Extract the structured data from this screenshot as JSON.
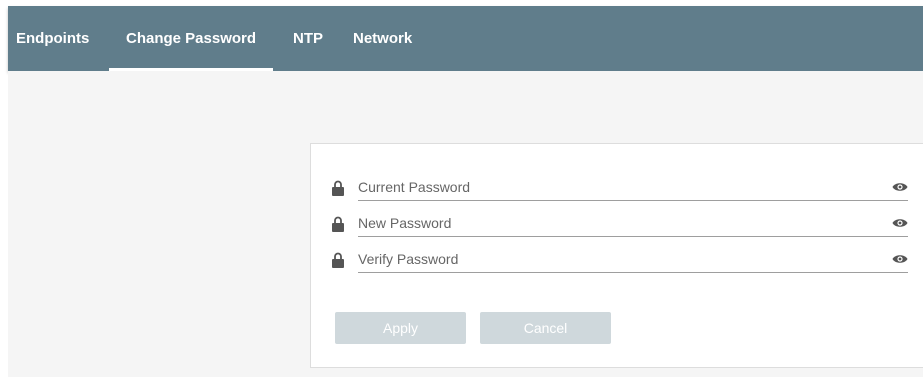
{
  "nav": {
    "tabs": [
      {
        "label": "Endpoints"
      },
      {
        "label": "Change Password"
      },
      {
        "label": "NTP"
      },
      {
        "label": "Network"
      }
    ],
    "active_tab": "Change Password"
  },
  "form": {
    "current_password": {
      "placeholder": "Current Password",
      "value": "",
      "icon": "lock-icon",
      "toggle_icon": "eye-icon"
    },
    "new_password": {
      "placeholder": "New Password",
      "value": "",
      "icon": "lock-icon",
      "toggle_icon": "eye-icon"
    },
    "verify_password": {
      "placeholder": "Verify Password",
      "value": "",
      "icon": "lock-icon",
      "toggle_icon": "eye-icon"
    },
    "apply_label": "Apply",
    "cancel_label": "Cancel"
  },
  "colors": {
    "header_bg": "#607d8b",
    "button_disabled": "#cfd8dc",
    "page_bg": "#f5f5f5"
  }
}
